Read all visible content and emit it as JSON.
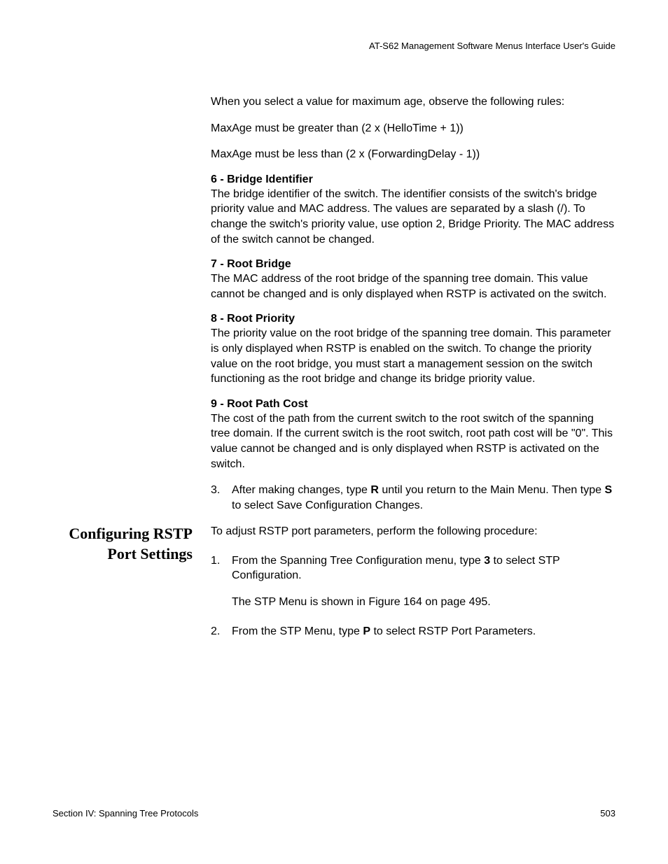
{
  "header": {
    "title": "AT-S62 Management Software Menus Interface User's Guide"
  },
  "topSection": {
    "p1": "When you select a value for maximum age, observe the following rules:",
    "p2": "MaxAge must be greater than (2 x (HelloTime + 1))",
    "p3": "MaxAge must be less than (2 x (ForwardingDelay - 1))"
  },
  "definitions": [
    {
      "heading": "6 - Bridge Identifier",
      "body": "The bridge identifier of the switch. The identifier consists of the switch's bridge priority value and MAC address. The values are separated by a slash (/). To change the switch's priority value, use option 2, Bridge Priority. The MAC address of the switch cannot be changed."
    },
    {
      "heading": "7 - Root Bridge",
      "body": "The MAC address of the root bridge of the spanning tree domain. This value cannot be changed and is only displayed when RSTP is activated on the switch."
    },
    {
      "heading": "8 - Root Priority",
      "body": "The priority value on the root bridge of the spanning tree domain. This parameter is only displayed when RSTP is enabled on the switch. To change the priority value on the root bridge, you must start a management session on the switch functioning as the root bridge and change its bridge priority value."
    },
    {
      "heading": "9 - Root Path Cost",
      "body": "The cost of the path from the current switch to the root switch of the spanning tree domain. If the current switch is the root switch, root path cost will be \"0\". This value cannot be changed and is only displayed when RSTP is activated on the switch."
    }
  ],
  "step3": {
    "num": "3.",
    "pre": "After making changes, type ",
    "bold1": "R",
    "mid": " until you return to the Main Menu. Then type ",
    "bold2": "S",
    "post": " to select Save Configuration Changes."
  },
  "section2": {
    "sidebarHeading": "Configuring RSTP Port Settings",
    "intro": "To adjust RSTP port parameters, perform the following procedure:",
    "step1": {
      "num": "1.",
      "pre": "From the Spanning Tree Configuration menu, type ",
      "bold": "3",
      "post": " to select STP Configuration."
    },
    "note": "The STP Menu is shown in Figure 164 on page 495.",
    "step2": {
      "num": "2.",
      "pre": "From the STP Menu, type ",
      "bold": "P",
      "post": " to select RSTP Port Parameters."
    }
  },
  "footer": {
    "left": "Section IV: Spanning Tree Protocols",
    "right": "503"
  }
}
